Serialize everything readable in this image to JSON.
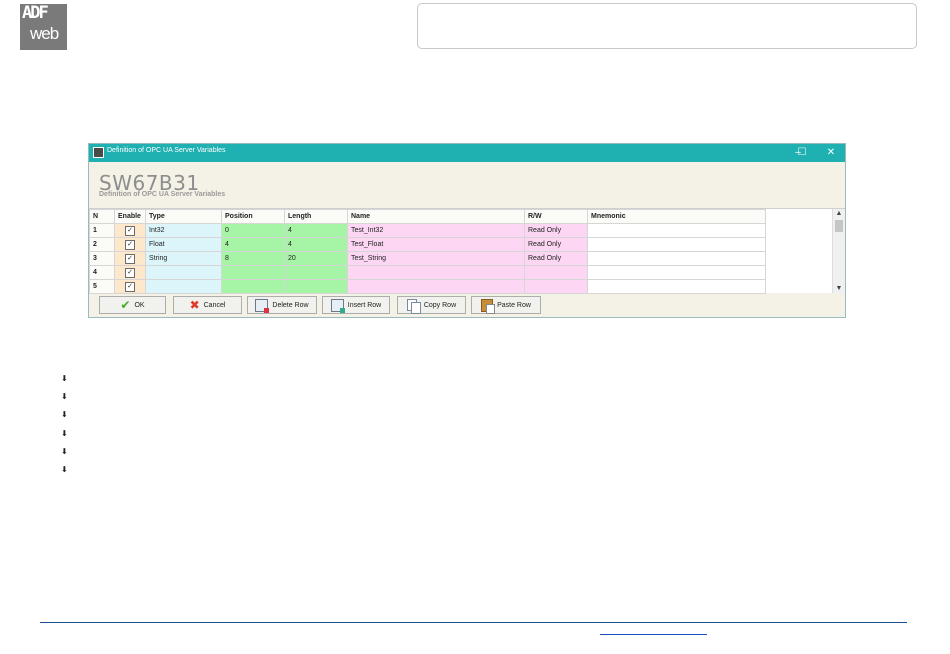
{
  "logo": {
    "line1": "ADF",
    "line2": "web"
  },
  "window": {
    "title": "Definition of OPC UA Server Variables",
    "controls": {
      "minimize": "–",
      "maximize": "☐",
      "close": "✕"
    },
    "heading": "SW67B31",
    "subheading": "Definition of OPC UA Server Variables"
  },
  "table": {
    "columns": [
      "N",
      "Enable",
      "Type",
      "Position",
      "Length",
      "Name",
      "R/W",
      "Mnemonic"
    ],
    "rows": [
      {
        "n": "1",
        "enable": true,
        "type": "Int32",
        "position": "0",
        "length": "4",
        "name": "Test_Int32",
        "rw": "Read Only",
        "mnemonic": ""
      },
      {
        "n": "2",
        "enable": true,
        "type": "Float",
        "position": "4",
        "length": "4",
        "name": "Test_Float",
        "rw": "Read Only",
        "mnemonic": ""
      },
      {
        "n": "3",
        "enable": true,
        "type": "String",
        "position": "8",
        "length": "20",
        "name": "Test_String",
        "rw": "Read Only",
        "mnemonic": ""
      },
      {
        "n": "4",
        "enable": true,
        "type": "",
        "position": "",
        "length": "",
        "name": "",
        "rw": "",
        "mnemonic": ""
      },
      {
        "n": "5",
        "enable": true,
        "type": "",
        "position": "",
        "length": "",
        "name": "",
        "rw": "",
        "mnemonic": ""
      }
    ]
  },
  "buttons": {
    "ok": "OK",
    "cancel": "Cancel",
    "delete_row": "Delete Row",
    "insert_row": "Insert Row",
    "copy_row": "Copy Row",
    "paste_row": "Paste Row"
  },
  "icons": {
    "bullet": "bullet-arrow-icon",
    "check": "✓"
  },
  "colors": {
    "titlebar": "#1fb0b2",
    "type_col": "#dcf5fb",
    "pos_len_col": "#a6f5a6",
    "name_rw_col": "#fcd6f3",
    "enable_col": "#fde8cc"
  }
}
